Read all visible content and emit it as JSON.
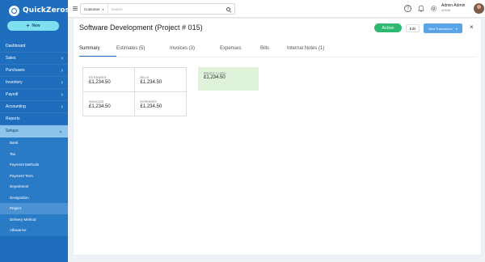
{
  "app": {
    "name": "QuickZeros"
  },
  "sidebar": {
    "new_label": "New",
    "items": [
      {
        "label": "Dashboard",
        "chevron": false
      },
      {
        "label": "Sales",
        "chevron": true
      },
      {
        "label": "Purchases",
        "chevron": true
      },
      {
        "label": "Inventory",
        "chevron": true
      },
      {
        "label": "Payroll",
        "chevron": true
      },
      {
        "label": "Accounting",
        "chevron": true
      },
      {
        "label": "Reports",
        "chevron": false
      },
      {
        "label": "Setups",
        "chevron": true
      }
    ],
    "subitems": [
      "Bank",
      "Tax",
      "Payment Methods",
      "Payment Term",
      "Department",
      "Designation",
      "Project",
      "Delivery Method",
      "Allowance"
    ],
    "chevron_right": "›",
    "chevron_down": "⌄"
  },
  "topbar": {
    "search_type": "Customer",
    "search_placeholder": "Search",
    "help_glyph": "?",
    "user_name": "Admin Admin",
    "user_role": "ADMIN"
  },
  "page": {
    "title": "Software Development (Project # 015)",
    "status": "Active",
    "edit_label": "Edit",
    "new_transaction_label": "New Transaction",
    "close_glyph": "×",
    "tabs": [
      "Summary",
      "Estimates (5)",
      "Invoices (3)",
      "Expenses",
      "Bills",
      "Internal Notes (1)"
    ],
    "summary": {
      "estimates_label": "ESTIMATES",
      "estimates_value": "£1,234.50",
      "bills_label": "BILLS",
      "bills_value": "£1,234.50",
      "invoices_label": "INVOICES",
      "invoices_value": "£1,234.50",
      "expenses_label": "EXPENSES",
      "expenses_value": "£1,234.50",
      "profit_label": "PROFIT / LOSS",
      "profit_value": "£1,234.50"
    }
  },
  "colors": {
    "sidebar_bg": "#1f6ebd",
    "active_status": "#2eb872",
    "primary_button": "#5aa4ea",
    "profit_bg": "#dff2da"
  }
}
